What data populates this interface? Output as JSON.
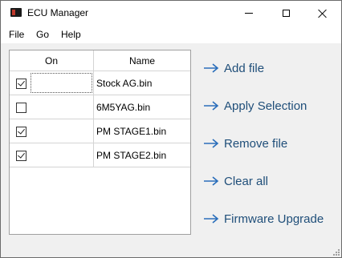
{
  "window": {
    "title": "ECU Manager",
    "controls": {
      "minimize": "minimize",
      "maximize": "maximize",
      "close": "close"
    }
  },
  "menu": {
    "items": [
      "File",
      "Go",
      "Help"
    ]
  },
  "grid": {
    "headers": {
      "on": "On",
      "name": "Name"
    },
    "rows": [
      {
        "on": true,
        "name": "Stock AG.bin"
      },
      {
        "on": false,
        "name": "6M5YAG.bin"
      },
      {
        "on": true,
        "name": "PM STAGE1.bin"
      },
      {
        "on": true,
        "name": "PM STAGE2.bin"
      }
    ]
  },
  "actions": {
    "add_file": "Add file",
    "apply_selection": "Apply Selection",
    "remove_file": "Remove file",
    "clear_all": "Clear all",
    "firmware_upgrade": "Firmware Upgrade"
  },
  "colors": {
    "action_text": "#1f4e79",
    "arrow": "#2a6ebb",
    "window_bg": "#f0f0f0"
  }
}
